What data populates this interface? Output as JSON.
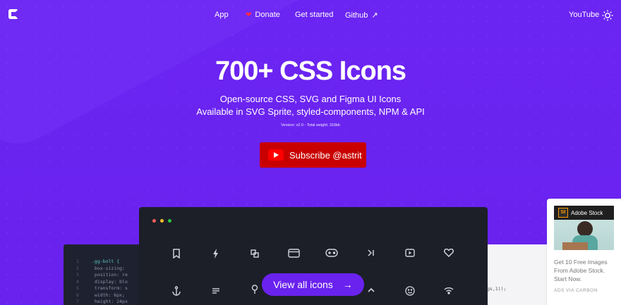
{
  "nav": {
    "items": [
      {
        "label": "App"
      },
      {
        "label": "Donate"
      },
      {
        "label": "Get started"
      },
      {
        "label": "Github",
        "suffix": "↗"
      }
    ],
    "right_label": "YouTube"
  },
  "hero": {
    "title": "700+ CSS Icons",
    "subtitle_line1": "Open-source CSS, SVG and Figma UI Icons",
    "subtitle_line2": "Available in SVG Sprite, styled-components, NPM & API",
    "meta": "Version: v2.0 - Total weight: 316kb",
    "subscribe_label": "Subscribe @astrit"
  },
  "code": {
    "lines": [
      {
        "n": "1",
        "text": ".gg-bolt {"
      },
      {
        "n": "2",
        "text": "    box-sizing:"
      },
      {
        "n": "3",
        "text": "    position: re"
      },
      {
        "n": "4",
        "text": "    display: blo"
      },
      {
        "n": "5",
        "text": "    transform: s"
      },
      {
        "n": "6",
        "text": "    width: 6px;"
      },
      {
        "n": "7",
        "text": "    height: 24px"
      }
    ],
    "right_snippet": "gs,1));"
  },
  "window": {
    "dots": [
      "#ff5f57",
      "#febc2e",
      "#28c840"
    ],
    "icons_row1": [
      "bookmark-icon",
      "bolt-icon",
      "copy-icon",
      "browser-icon",
      "gamepad-icon",
      "skip-icon",
      "play-button-icon",
      "heart-icon"
    ],
    "icons_row2": [
      "anchor-icon",
      "align-icon",
      "pin-icon",
      "chevron-up-icon",
      "smile-icon",
      "wifi-icon"
    ]
  },
  "cta": {
    "label": "View all icons",
    "arrow": "→"
  },
  "ad": {
    "brand": "Adobe Stock",
    "logo_text": "St",
    "text": "Get 10 Free Images From Adobe Stock. Start Now.",
    "via": "ADS VIA CARBON"
  },
  "colors": {
    "background": "#6a22ee",
    "subscribe": "#c90000",
    "window": "#1c1f28"
  }
}
